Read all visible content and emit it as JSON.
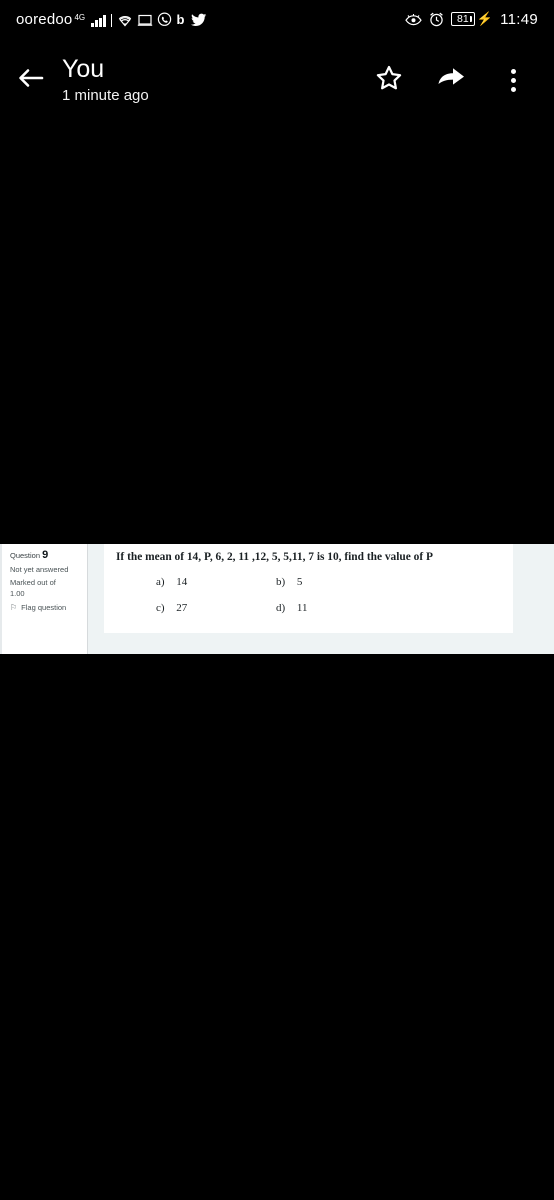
{
  "statusbar": {
    "carrier": "ooredoo",
    "network_type": "4G",
    "icons": [
      "signal-bars-icon",
      "wifi-icon",
      "cast-screen-icon",
      "whatsapp-icon",
      "bitly-b-icon",
      "twitter-bird-icon"
    ],
    "eye_icon": "eye-icon",
    "alarm_icon": "alarm-clock-icon",
    "battery_level": "81",
    "charging_icon": "charging-bolt-icon",
    "time": "11:49"
  },
  "appbar": {
    "back_icon": "back-arrow-icon",
    "title": "You",
    "subtitle": "1 minute ago",
    "star_icon": "star-outline-icon",
    "share_icon": "share-arrow-icon",
    "overflow_icon": "more-vertical-icon"
  },
  "shared_image": {
    "type": "moodle-quiz-question-screenshot",
    "sidebar": {
      "question_label": "Question",
      "question_number": "9",
      "status": "Not yet answered",
      "marks_label": "Marked out of",
      "marks_value": "1.00",
      "flag_icon": "flag-icon",
      "flag_label": "Flag question"
    },
    "question_text": "If the mean of 14, P, 6, 2, 11 ,12, 5, 5,11, 7 is 10, find the value of P",
    "options": [
      {
        "label": "a)",
        "value": "14"
      },
      {
        "label": "b)",
        "value": "5"
      },
      {
        "label": "c)",
        "value": "27"
      },
      {
        "label": "d)",
        "value": "11"
      }
    ]
  },
  "colors": {
    "app_background": "#000000",
    "text_primary": "#ffffff",
    "image_background": "#eef3f4",
    "card_background": "#ffffff"
  }
}
